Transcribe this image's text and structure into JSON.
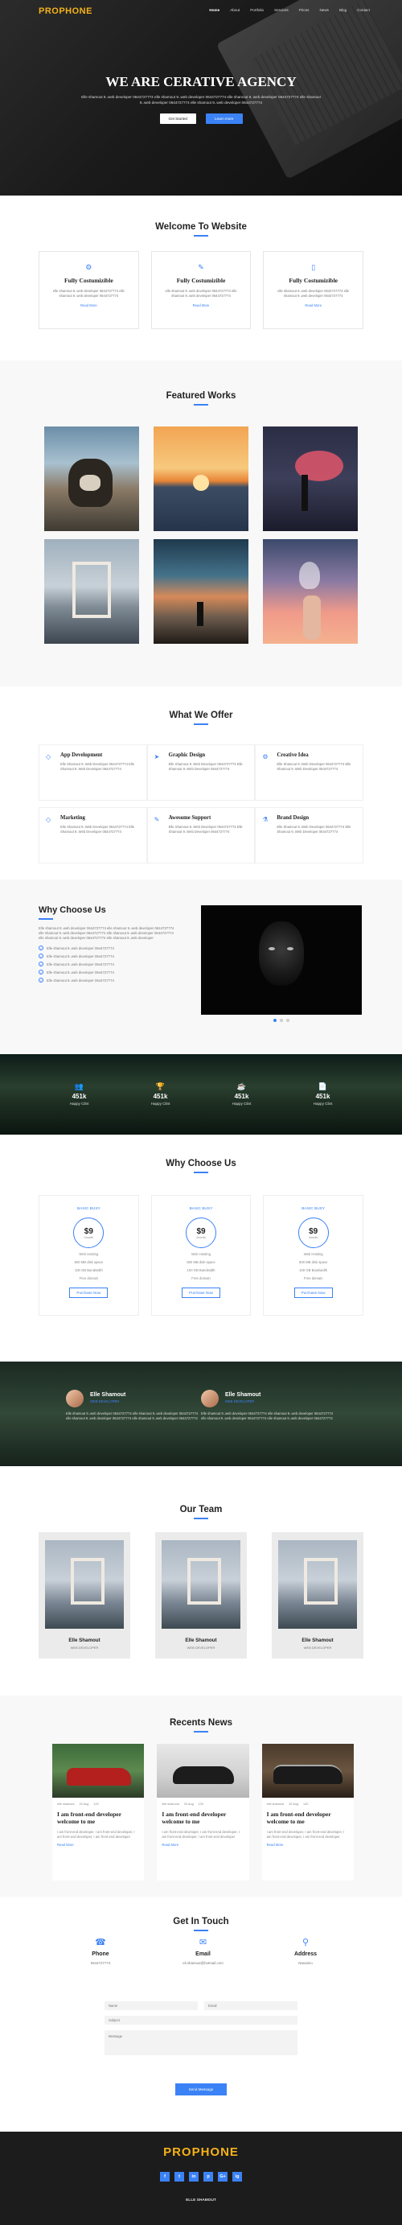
{
  "brand": {
    "logo": "PROPHONE",
    "accent": "#3b82f6",
    "logo_color": "#f5b21a"
  },
  "nav": {
    "items": [
      "Home",
      "About",
      "Portfolio",
      "Services",
      "Prices",
      "News",
      "Blog",
      "Contact"
    ],
    "active": "Home"
  },
  "hero": {
    "title": "WE ARE CERATIVE AGENCY",
    "subtitle": "Elle shamout 9..web developer 0644727774 elle shamout 9..web developer 0644727774 elle shamout 9..web developer 0644727774 elle shamout 9..web developer 0644727774 elle shamout 9..web developer 0644727774",
    "btn_primary": "Get Started",
    "btn_secondary": "Learn more"
  },
  "welcome": {
    "heading": "Welcome To Website",
    "cards": [
      {
        "icon": "cogs-icon",
        "title": "Fully Costumizible",
        "desc": "elle shamout 9..web developer 0644727774 elle shamout 9..web developer 0644727774",
        "link": "Read More"
      },
      {
        "icon": "magic-wand-icon",
        "title": "Fully Costumizible",
        "desc": "elle shamout 9..web developer 0644727774 elle shamout 9..web developer 0644727774",
        "link": "Read More"
      },
      {
        "icon": "mobile-icon",
        "title": "Fully Costumizible",
        "desc": "elle shamout 9..web developer 0644727774 elle shamout 9..web developer 0644727774",
        "link": "Read More"
      }
    ]
  },
  "featured": {
    "heading": "Featured Works"
  },
  "offer": {
    "heading": "What We Offer",
    "items": [
      {
        "icon": "diamond-icon",
        "title": "App Development",
        "desc": "Elle Shamout 9..Web Developer 0644727774 Elle Shamout 9..Web Developer 0644727774"
      },
      {
        "icon": "paper-plane-icon",
        "title": "Graphic Design",
        "desc": "Elle Shamout 9..Web Developer 0644727774 Elle Shamout 9..Web Developer 0644727774"
      },
      {
        "icon": "cogs-icon",
        "title": "Creative Idea",
        "desc": "Elle Shamout 9..Web Developer 0644727774 Elle Shamout 9..Web Developer 0644727774"
      },
      {
        "icon": "diamond-icon",
        "title": "Marketing",
        "desc": "Elle Shamout 9..Web Developer 0644727774 Elle Shamout 9..Web Developer 0644727774"
      },
      {
        "icon": "pencil-icon",
        "title": "Awesome Support",
        "desc": "Elle Shamout 9..Web Developer 0644727774 Elle Shamout 9..Web Developer 0644727774"
      },
      {
        "icon": "flask-icon",
        "title": "Brand Design",
        "desc": "Elle Shamout 9..Web Developer 0644727774 Elle Shamout 9..Web Developer 0644727774"
      }
    ]
  },
  "why": {
    "heading": "Why Choose Us",
    "desc": "Elle shamout 9..web developer 0644727774 elle shamout 9..web developer 0644727774 elle shamout 9..web developer 0644727774 elle shamout 9..web developer 0644727774 elle shamout 9..web developer 0644727774 elle shamout 9..web developer",
    "checks": [
      "Elle shamout 9..web developer 0644727774",
      "Elle shamout 9..web developer 0644727774",
      "Elle shamout 9..web developer 0644727774",
      "Elle shamout 9..web developer 0644727774",
      "Elle shamout 9..web developer 0644727774"
    ]
  },
  "stats": [
    {
      "icon": "users-icon",
      "value": "451k",
      "label": "Happy Clint"
    },
    {
      "icon": "trophy-icon",
      "value": "451k",
      "label": "Happy Clint"
    },
    {
      "icon": "coffee-icon",
      "value": "451k",
      "label": "Happy Clint"
    },
    {
      "icon": "file-icon",
      "value": "451k",
      "label": "Happy Clint"
    }
  ],
  "pricing": {
    "heading": "Why Choose Us",
    "plans": [
      {
        "title": "BASIC BUSY",
        "price": "$9",
        "per": "/month",
        "features": [
          "Web Hosting",
          "500 MB disk space",
          "100 GB Bandwidth",
          "Free domain"
        ],
        "button": "Purchase Now"
      },
      {
        "title": "BASIC BUSY",
        "price": "$9",
        "per": "/month",
        "features": [
          "Web Hosting",
          "500 MB disk space",
          "100 GB Bandwidth",
          "Free domain"
        ],
        "button": "Purchase Now"
      },
      {
        "title": "BASIC BUSY",
        "price": "$9",
        "per": "/month",
        "features": [
          "Web Hosting",
          "500 MB disk space",
          "100 GB Bandwidth",
          "Free domain"
        ],
        "button": "Purchase Now"
      }
    ]
  },
  "testimonials": [
    {
      "name": "Elle Shamout",
      "role": "WEB DEVELOPER",
      "text": "Elle shamout 9..web developer 0644727774 elle shamout 9..web developer 0644727774 elle shamout 9..web developer 0644727774 elle shamout 9..web developer 0644727774"
    },
    {
      "name": "Elle Shamout",
      "role": "WEB DEVELOPER",
      "text": "Elle shamout 9..web developer 0644727774 elle shamout 9..web developer 0644727774 elle shamout 9..web developer 0644727774 elle shamout 9..web developer 0644727774"
    }
  ],
  "team": {
    "heading": "Our Team",
    "members": [
      {
        "name": "Elle Shamout",
        "role": "WEB DEVELOPER"
      },
      {
        "name": "Elle Shamout",
        "role": "WEB DEVELOPER"
      },
      {
        "name": "Elle Shamout",
        "role": "WEB DEVELOPER"
      }
    ]
  },
  "news": {
    "heading": "Recents News",
    "posts": [
      {
        "meta": [
          "elle shamout",
          "20 Aug",
          "120"
        ],
        "title": "I am front-end developer welcome to me",
        "desc": "I am front-end developer, I am front-end developer, I am front-end developer, I am front-end developer",
        "link": "Read More"
      },
      {
        "meta": [
          "elle shamout",
          "20 Aug",
          "120"
        ],
        "title": "I am front-end developer welcome to me",
        "desc": "I am front-end developer, I am front-end developer, I am front-end developer, I am front-end developer",
        "link": "Read More"
      },
      {
        "meta": [
          "elle shamout",
          "20 Aug",
          "120"
        ],
        "title": "I am front-end developer welcome to me",
        "desc": "I am front-end developer, I am front-end developer, I am front-end developer, I am front-end developer",
        "link": "Read More"
      }
    ]
  },
  "contact": {
    "heading": "Get In Touch",
    "info": [
      {
        "icon": "phone-icon",
        "title": "Phone",
        "value": "0644727774"
      },
      {
        "icon": "envelope-icon",
        "title": "Email",
        "value": "eli.shamout@hotmail.com"
      },
      {
        "icon": "map-marker-icon",
        "title": "Address",
        "value": "Nanaimo"
      }
    ],
    "form": {
      "name_ph": "Name",
      "email_ph": "Email",
      "subject_ph": "Subject",
      "message_ph": "Message",
      "send": "Send Message"
    }
  },
  "footer": {
    "logo": "PROPHONE",
    "socials": [
      "f",
      "t",
      "in",
      "p",
      "G+",
      "ig"
    ],
    "copy": "ELLE SHAMOUT"
  }
}
